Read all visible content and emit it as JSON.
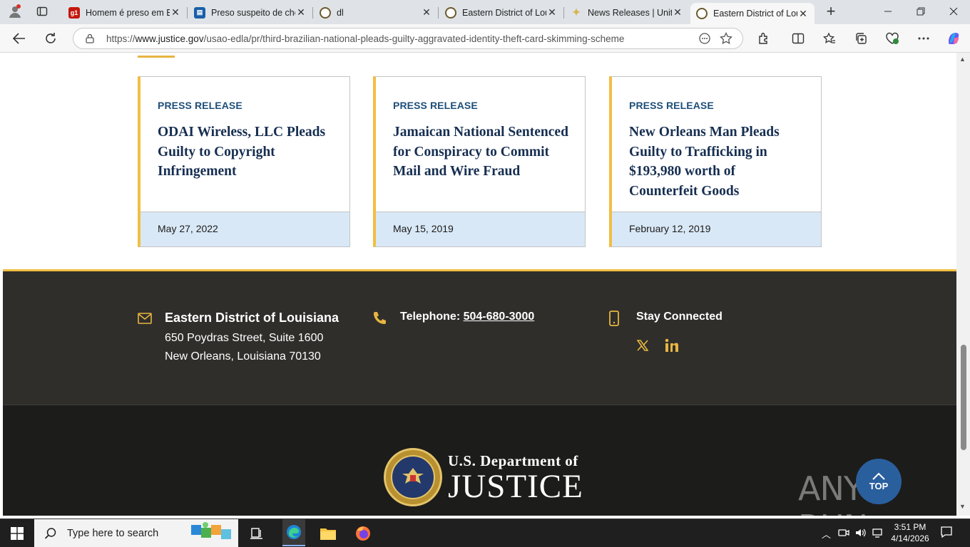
{
  "browser": {
    "tabs": [
      {
        "title": "Homem é preso em B",
        "icon": "g1-icon"
      },
      {
        "title": "Preso suspeito de che",
        "icon": "news-doc-icon"
      },
      {
        "title": "dl",
        "icon": "doj-seal-icon"
      },
      {
        "title": "Eastern District of Lou",
        "icon": "doj-seal-icon"
      },
      {
        "title": "News Releases | Unite",
        "icon": "star-icon"
      },
      {
        "title": "Eastern District of Lou",
        "icon": "doj-seal-icon",
        "active": true
      }
    ],
    "url_prefix": "https://",
    "url_host": "www.justice.gov",
    "url_path": "/usao-edla/pr/third-brazilian-national-pleads-guilty-aggravated-identity-theft-card-skimming-scheme"
  },
  "cards": [
    {
      "kicker": "PRESS RELEASE",
      "title": "ODAI Wireless, LLC Pleads Guilty to Copyright Infringement",
      "date": "May 27, 2022"
    },
    {
      "kicker": "PRESS RELEASE",
      "title": "Jamaican National Sentenced for Conspiracy to Commit Mail and Wire Fraud",
      "date": "May 15, 2019"
    },
    {
      "kicker": "PRESS RELEASE",
      "title": "New Orleans Man Pleads Guilty to Trafficking in $193,980 worth of Counterfeit Goods",
      "date": "February 12, 2019"
    }
  ],
  "footer": {
    "office_name": "Eastern District of Louisiana",
    "address_line1": "650 Poydras Street, Suite 1600",
    "address_line2": "New Orleans, Louisiana 70130",
    "telephone_label": "Telephone: ",
    "telephone_number": "504-680-3000",
    "stay_connected": "Stay Connected",
    "social": [
      "x-icon",
      "linkedin-icon"
    ],
    "logo_line1": "U.S. Department of",
    "logo_line2": "JUSTICE",
    "top_button": "TOP"
  },
  "taskbar": {
    "search_placeholder": "Type here to search",
    "time": "3:51 PM",
    "date": "4/14/2026"
  },
  "colors": {
    "gold": "#f2be42",
    "navy": "#162e51",
    "kicker_blue": "#1f4f79",
    "date_bg": "#d9e8f6",
    "footer_bg": "#2f2e2b"
  }
}
